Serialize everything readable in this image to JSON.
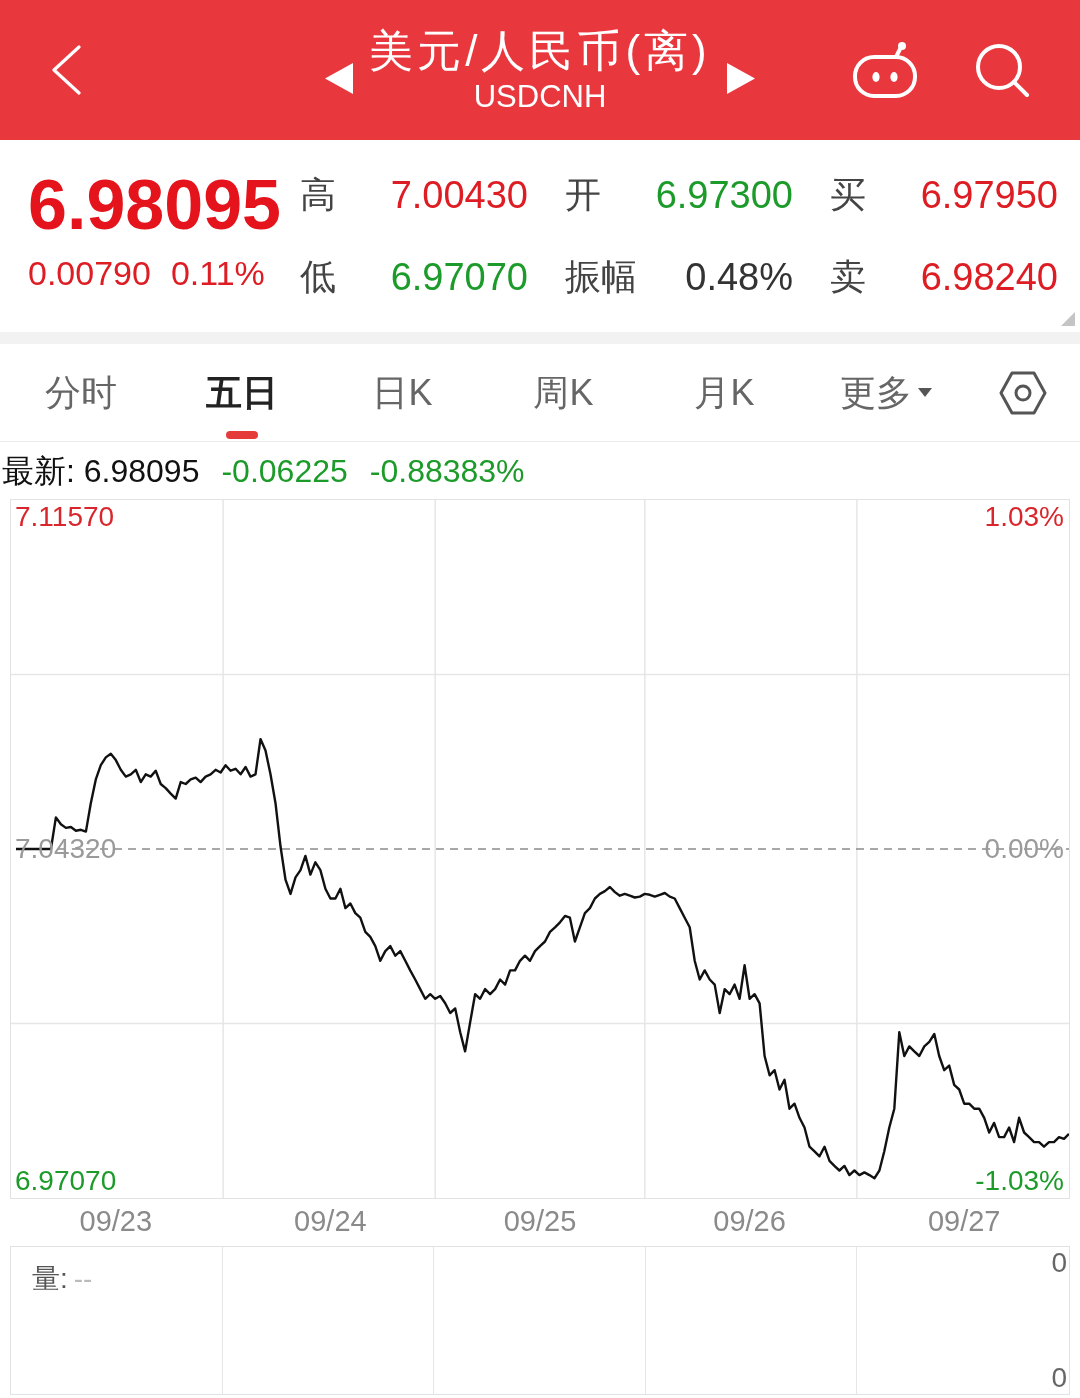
{
  "header": {
    "title": "美元/人民币(离)",
    "subtitle": "USDCNH"
  },
  "quote": {
    "price": "6.98095",
    "change": "0.00790",
    "change_pct": "0.11%",
    "stats": [
      {
        "label": "高",
        "value": "7.00430",
        "color": "#dd1c23"
      },
      {
        "label": "开",
        "value": "6.97300",
        "color": "#1c9b2a"
      },
      {
        "label": "买",
        "value": "6.97950",
        "color": "#dd1c23"
      },
      {
        "label": "低",
        "value": "6.97070",
        "color": "#1c9b2a"
      },
      {
        "label": "振幅",
        "value": "0.48%",
        "color": "#333333"
      },
      {
        "label": "卖",
        "value": "6.98240",
        "color": "#dd1c23"
      }
    ]
  },
  "tabs": [
    {
      "label": "分时",
      "selected": false,
      "kind": "tab"
    },
    {
      "label": "五日",
      "selected": true,
      "kind": "tab"
    },
    {
      "label": "日K",
      "selected": false,
      "kind": "tab"
    },
    {
      "label": "周K",
      "selected": false,
      "kind": "tab"
    },
    {
      "label": "月K",
      "selected": false,
      "kind": "tab"
    },
    {
      "label": "更多",
      "selected": false,
      "kind": "dropdown"
    }
  ],
  "latest": {
    "text": "最新: 6.98095",
    "change": "-0.06225",
    "change_pct": "-0.88383%"
  },
  "chart": {
    "percent_labels": [
      "1.03%",
      "0.00%",
      "-1.03%"
    ],
    "chart_data": {
      "type": "line",
      "categories": [
        null,
        null,
        null,
        null,
        null,
        null,
        null,
        null,
        null,
        null,
        null,
        null,
        null,
        null,
        null,
        null,
        null,
        null,
        null,
        null,
        "09/23",
        null,
        null,
        null,
        null,
        null,
        null,
        null,
        null,
        null,
        null,
        null,
        null,
        null,
        null,
        null,
        null,
        null,
        null,
        null,
        null,
        null,
        null,
        null,
        null,
        null,
        null,
        null,
        null,
        null,
        null,
        null,
        null,
        null,
        null,
        null,
        null,
        null,
        null,
        null,
        null,
        null,
        null,
        "09/24",
        null,
        null,
        null,
        null,
        null,
        null,
        null,
        null,
        null,
        null,
        null,
        null,
        null,
        null,
        null,
        null,
        null,
        null,
        null,
        null,
        null,
        null,
        null,
        null,
        null,
        null,
        null,
        null,
        null,
        null,
        null,
        null,
        null,
        null,
        null,
        null,
        null,
        null,
        null,
        null,
        null,
        "09/25",
        null,
        null,
        null,
        null,
        null,
        null,
        null,
        null,
        null,
        null,
        null,
        null,
        null,
        null,
        null,
        null,
        null,
        null,
        null,
        null,
        null,
        null,
        null,
        null,
        null,
        null,
        null,
        null,
        null,
        null,
        null,
        null,
        null,
        null,
        null,
        null,
        null,
        null,
        null,
        null,
        null,
        "09/26",
        null,
        null,
        null,
        null,
        null,
        null,
        null,
        null,
        null,
        null,
        null,
        null,
        null,
        null,
        null,
        null,
        null,
        null,
        null,
        null,
        null,
        null,
        null,
        null,
        null,
        null,
        null,
        null,
        null,
        null,
        null,
        null,
        null,
        null,
        null,
        null,
        null,
        null,
        null,
        null,
        null,
        null,
        "09/27",
        null,
        null,
        null,
        null,
        null,
        null,
        null,
        null,
        null,
        null,
        null,
        null,
        null,
        null,
        null,
        null,
        null,
        null,
        null,
        null,
        null
      ],
      "series": [
        {
          "color": "#8c8c8c",
          "line_style": "dashed",
          "values": [
            7.0432,
            7.0432,
            7.0432,
            7.0432,
            7.0432,
            7.0432,
            7.0432,
            7.0432,
            7.0432,
            7.0432,
            7.0432,
            7.0432,
            7.0432,
            7.0432,
            7.0432,
            7.0432,
            7.0432,
            7.0432,
            7.0432,
            7.0432,
            7.0432,
            7.0432,
            7.0432,
            7.0432,
            7.0432,
            7.0432,
            7.0432,
            7.0432,
            7.0432,
            7.0432,
            7.0432,
            7.0432,
            7.0432,
            7.0432,
            7.0432,
            7.0432,
            7.0432,
            7.0432,
            7.0432,
            7.0432,
            7.0432,
            7.0432,
            7.0432,
            7.0432,
            7.0432,
            7.0432,
            7.0432,
            7.0432,
            7.0432,
            7.0432,
            7.0432,
            7.0432,
            7.0432,
            7.0432,
            7.0432,
            7.0432,
            7.0432,
            7.0432,
            7.0432,
            7.0432,
            7.0432,
            7.0432,
            7.0432,
            7.0432,
            7.0432,
            7.0432,
            7.0432,
            7.0432,
            7.0432,
            7.0432,
            7.0432,
            7.0432,
            7.0432,
            7.0432,
            7.0432,
            7.0432,
            7.0432,
            7.0432,
            7.0432,
            7.0432,
            7.0432,
            7.0432,
            7.0432,
            7.0432,
            7.0432,
            7.0432,
            7.0432,
            7.0432,
            7.0432,
            7.0432,
            7.0432,
            7.0432,
            7.0432,
            7.0432,
            7.0432,
            7.0432,
            7.0432,
            7.0432,
            7.0432,
            7.0432,
            7.0432,
            7.0432,
            7.0432,
            7.0432,
            7.0432,
            7.0432,
            7.0432,
            7.0432,
            7.0432,
            7.0432,
            7.0432,
            7.0432,
            7.0432,
            7.0432,
            7.0432,
            7.0432,
            7.0432,
            7.0432,
            7.0432,
            7.0432,
            7.0432,
            7.0432,
            7.0432,
            7.0432,
            7.0432,
            7.0432,
            7.0432,
            7.0432,
            7.0432,
            7.0432,
            7.0432,
            7.0432,
            7.0432,
            7.0432,
            7.0432,
            7.0432,
            7.0432,
            7.0432,
            7.0432,
            7.0432,
            7.0432,
            7.0432,
            7.0432,
            7.0432,
            7.0432,
            7.0432,
            7.0432,
            7.0432,
            7.0432,
            7.0432,
            7.0432,
            7.0432,
            7.0432,
            7.0432,
            7.0432,
            7.0432,
            7.0432,
            7.0432,
            7.0432,
            7.0432,
            7.0432,
            7.0432,
            7.0432,
            7.0432,
            7.0432,
            7.0432,
            7.0432,
            7.0432,
            7.0432,
            7.0432,
            7.0432,
            7.0432,
            7.0432,
            7.0432,
            7.0432,
            7.0432,
            7.0432,
            7.0432,
            7.0432,
            7.0432,
            7.0432,
            7.0432,
            7.0432,
            7.0432,
            7.0432,
            7.0432,
            7.0432,
            7.0432,
            7.0432,
            7.0432,
            7.0432,
            7.0432,
            7.0432,
            7.0432,
            7.0432,
            7.0432,
            7.0432,
            7.0432,
            7.0432,
            7.0432,
            7.0432,
            7.0432,
            7.0432,
            7.0432,
            7.0432,
            7.0432,
            7.0432,
            7.0432,
            7.0432,
            7.0432,
            7.0432,
            7.0432
          ]
        },
        {
          "color": "#111111",
          "values": [
            7.0432,
            7.0432,
            7.0432,
            7.0432,
            7.0432,
            7.0432,
            7.0432,
            7.0432,
            7.0501,
            7.0486,
            7.0478,
            7.048,
            7.0472,
            7.0474,
            7.047,
            7.0532,
            7.0584,
            7.0615,
            7.0632,
            7.064,
            7.0626,
            7.0605,
            7.059,
            7.0595,
            7.0605,
            7.0578,
            7.0595,
            7.059,
            7.0603,
            7.0574,
            7.0565,
            7.0553,
            7.0542,
            7.0578,
            7.0574,
            7.0584,
            7.0588,
            7.0578,
            7.059,
            7.0595,
            7.0605,
            7.0599,
            7.0615,
            7.0603,
            7.0607,
            7.0595,
            7.0611,
            7.059,
            7.0595,
            7.0672,
            7.0647,
            7.0595,
            7.0532,
            7.0438,
            7.0365,
            7.0334,
            7.037,
            7.0386,
            7.0417,
            7.0376,
            7.0403,
            7.0386,
            7.0345,
            7.0324,
            7.0324,
            7.0345,
            7.0303,
            7.0313,
            7.0292,
            7.0282,
            7.0251,
            7.024,
            7.022,
            7.0188,
            7.0209,
            7.022,
            7.0199,
            7.0209,
            7.0188,
            7.0167,
            7.0147,
            7.0126,
            7.0105,
            7.0115,
            7.0105,
            7.0111,
            7.0095,
            7.0074,
            7.0084,
            7.0032,
            6.999,
            7.0053,
            7.0115,
            7.0105,
            7.0126,
            7.0115,
            7.0126,
            7.0147,
            7.0136,
            7.0167,
            7.0167,
            7.0188,
            7.0199,
            7.0188,
            7.0209,
            7.022,
            7.023,
            7.0251,
            7.0261,
            7.0272,
            7.0286,
            7.0282,
            7.023,
            7.0261,
            7.0292,
            7.0303,
            7.0324,
            7.0334,
            7.034,
            7.0349,
            7.0338,
            7.033,
            7.0334,
            7.033,
            7.0326,
            7.0328,
            7.0334,
            7.0332,
            7.0328,
            7.0332,
            7.0336,
            7.0328,
            7.0324,
            7.0303,
            7.0282,
            7.0261,
            7.0188,
            7.0147,
            7.0167,
            7.0147,
            7.0136,
            7.0074,
            7.0126,
            7.0115,
            7.0136,
            7.0105,
            7.0178,
            7.0105,
            7.0115,
            7.0095,
            6.998,
            6.9938,
            6.9949,
            6.9907,
            6.9928,
            6.9865,
            6.9876,
            6.9845,
            6.9824,
            6.9782,
            6.9772,
            6.9761,
            6.9782,
            6.9751,
            6.974,
            6.973,
            6.974,
            6.972,
            6.973,
            6.972,
            6.9726,
            6.972,
            6.9713,
            6.973,
            6.9772,
            6.9824,
            6.9865,
            7.0032,
            6.998,
            7.0001,
            6.999,
            6.998,
            7.0001,
            7.0011,
            7.0028,
            6.998,
            6.9949,
            6.9959,
            6.9917,
            6.9907,
            6.9876,
            6.9876,
            6.9865,
            6.9865,
            6.9845,
            6.9813,
            6.9834,
            6.9803,
            6.9803,
            6.9824,
            6.9792,
            6.9845,
            6.9813,
            6.9803,
            6.9792,
            6.9792,
            6.9782,
            6.9792,
            6.9792,
            6.9803,
            6.9799,
            6.981
          ]
        }
      ],
      "ylim": [
        6.967,
        7.1194
      ],
      "yticks": [
        {
          "value": 7.1157,
          "label": "7.11570"
        },
        {
          "value": 7.0432,
          "label": "7.04320"
        },
        {
          "value": 6.9707,
          "label": "6.97070"
        }
      ]
    }
  },
  "volume": {
    "label": "量:",
    "value": "--",
    "axis_labels": [
      "0",
      "0"
    ]
  }
}
